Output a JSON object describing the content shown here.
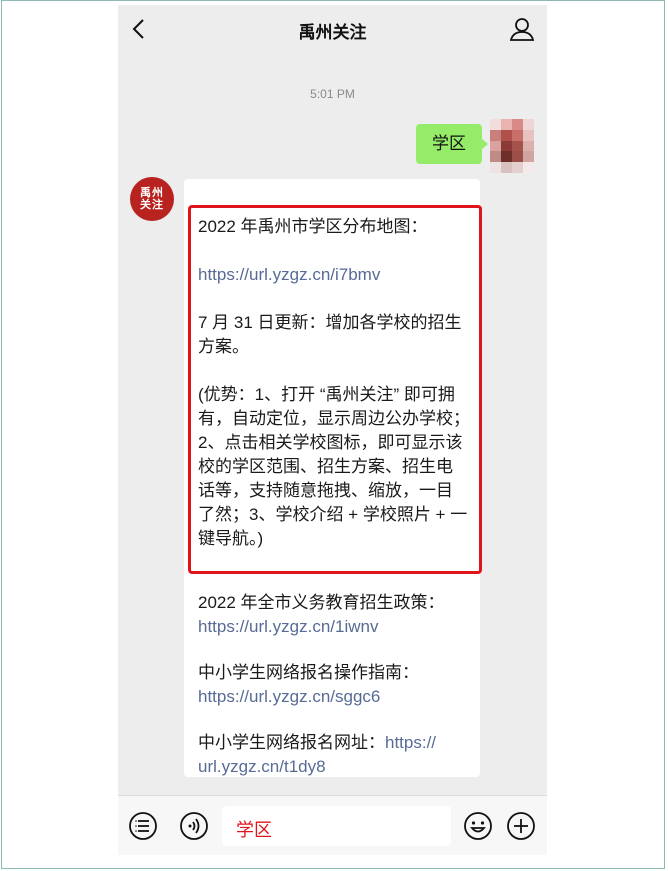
{
  "header": {
    "title": "禹州关注"
  },
  "chat": {
    "time": "5:01 PM",
    "my_message": "学区",
    "bot_avatar_text_line1": "禹州",
    "bot_avatar_text_line2": "关注",
    "reply": {
      "line1": "2022 年禹州市学区分布地图：",
      "link1": "https://url.yzgz.cn/i7bmv",
      "update_line1": "7 月 31 日更新：增加各学校的招生",
      "update_line2": "方案。",
      "adv_lines": [
        "(优势：1、打开 “禹州关注” 即可拥",
        "有，自动定位，显示周边公办学校；",
        "2、点击相关学校图标，即可显示该",
        "校的学区范围、招生方案、招生电",
        "话等，支持随意拖拽、缩放，一目",
        "了然；3、学校介绍 + 学校照片 + 一",
        "键导航。)"
      ],
      "policy_title": "2022 年全市义务教育招生政策：",
      "policy_link": "https://url.yzgz.cn/1iwnv",
      "guide_title": "中小学生网络报名操作指南：",
      "guide_link": "https://url.yzgz.cn/sggc6",
      "signup_title": "中小学生网络报名网址：",
      "signup_link_part1": "https://",
      "signup_link_part2": "url.yzgz.cn/t1dy8"
    }
  },
  "input": {
    "value": "学区"
  },
  "colors": {
    "my_bubble": "#95ec69",
    "highlight": "#e0151c",
    "link": "#576b95",
    "bot_avatar": "#b8231f"
  },
  "icons": [
    "back-icon",
    "profile-icon",
    "menu-list-icon",
    "voice-icon",
    "emoji-icon",
    "plus-icon"
  ]
}
